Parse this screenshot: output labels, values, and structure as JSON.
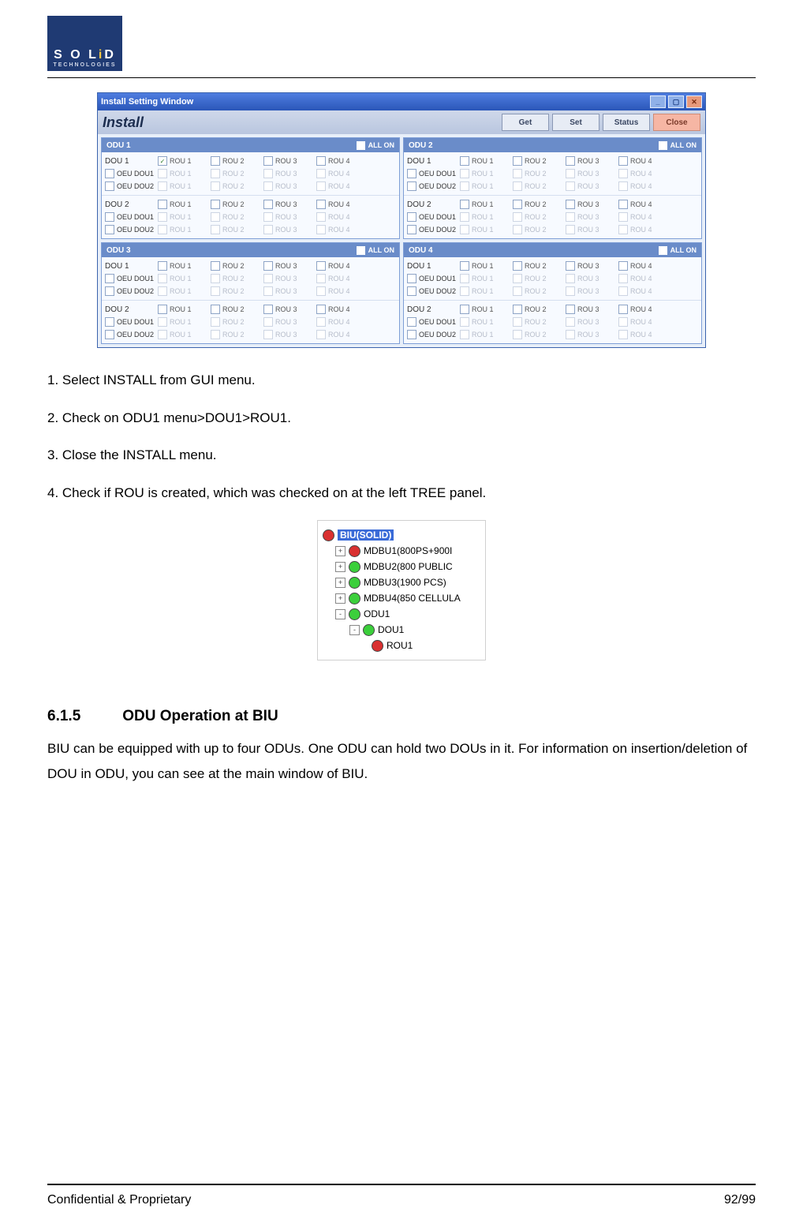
{
  "logo": {
    "brand": "SOLiD",
    "sub": "TECHNOLOGIES"
  },
  "installWindow": {
    "title": "Install Setting Window",
    "heading": "Install",
    "buttons": {
      "get": "Get",
      "set": "Set",
      "status": "Status",
      "close": "Close"
    },
    "allOn": "ALL ON",
    "panels": [
      {
        "name": "ODU 1",
        "checked": [
          "DOU1_ROU1"
        ]
      },
      {
        "name": "ODU 2",
        "checked": []
      },
      {
        "name": "ODU 3",
        "checked": []
      },
      {
        "name": "ODU 4",
        "checked": []
      }
    ],
    "labels": {
      "dou1": "DOU 1",
      "dou2": "DOU 2",
      "oeu1": "OEU DOU1",
      "oeu2": "OEU DOU2",
      "rou1": "ROU 1",
      "rou2": "ROU 2",
      "rou3": "ROU 3",
      "rou4": "ROU 4"
    }
  },
  "instructions": [
    "1. Select INSTALL from GUI menu.",
    "2. Check on ODU1 menu>DOU1>ROU1.",
    "3. Close the INSTALL menu.",
    "4. Check if ROU is created, which was checked on at the left TREE panel."
  ],
  "tree": {
    "root": "BIU(SOLID)",
    "items": [
      {
        "exp": "+",
        "color": "red",
        "label": "MDBU1(800PS+900I"
      },
      {
        "exp": "+",
        "color": "green",
        "label": "MDBU2(800 PUBLIC"
      },
      {
        "exp": "+",
        "color": "green",
        "label": "MDBU3(1900 PCS)"
      },
      {
        "exp": "+",
        "color": "green",
        "label": "MDBU4(850 CELLULA"
      },
      {
        "exp": "-",
        "color": "green",
        "label": "ODU1"
      }
    ],
    "sub": {
      "exp": "-",
      "color": "green",
      "label": "DOU1"
    },
    "leaf": {
      "color": "red",
      "label": "ROU1"
    }
  },
  "section": {
    "num": "6.1.5",
    "title": "ODU Operation at BIU"
  },
  "paragraph": "BIU can be equipped with up to four ODUs. One ODU can hold two DOUs in it. For information on insertion/deletion of DOU in ODU, you can see at the main window of BIU.",
  "footer": {
    "left": "Confidential & Proprietary",
    "right": "92/99"
  }
}
